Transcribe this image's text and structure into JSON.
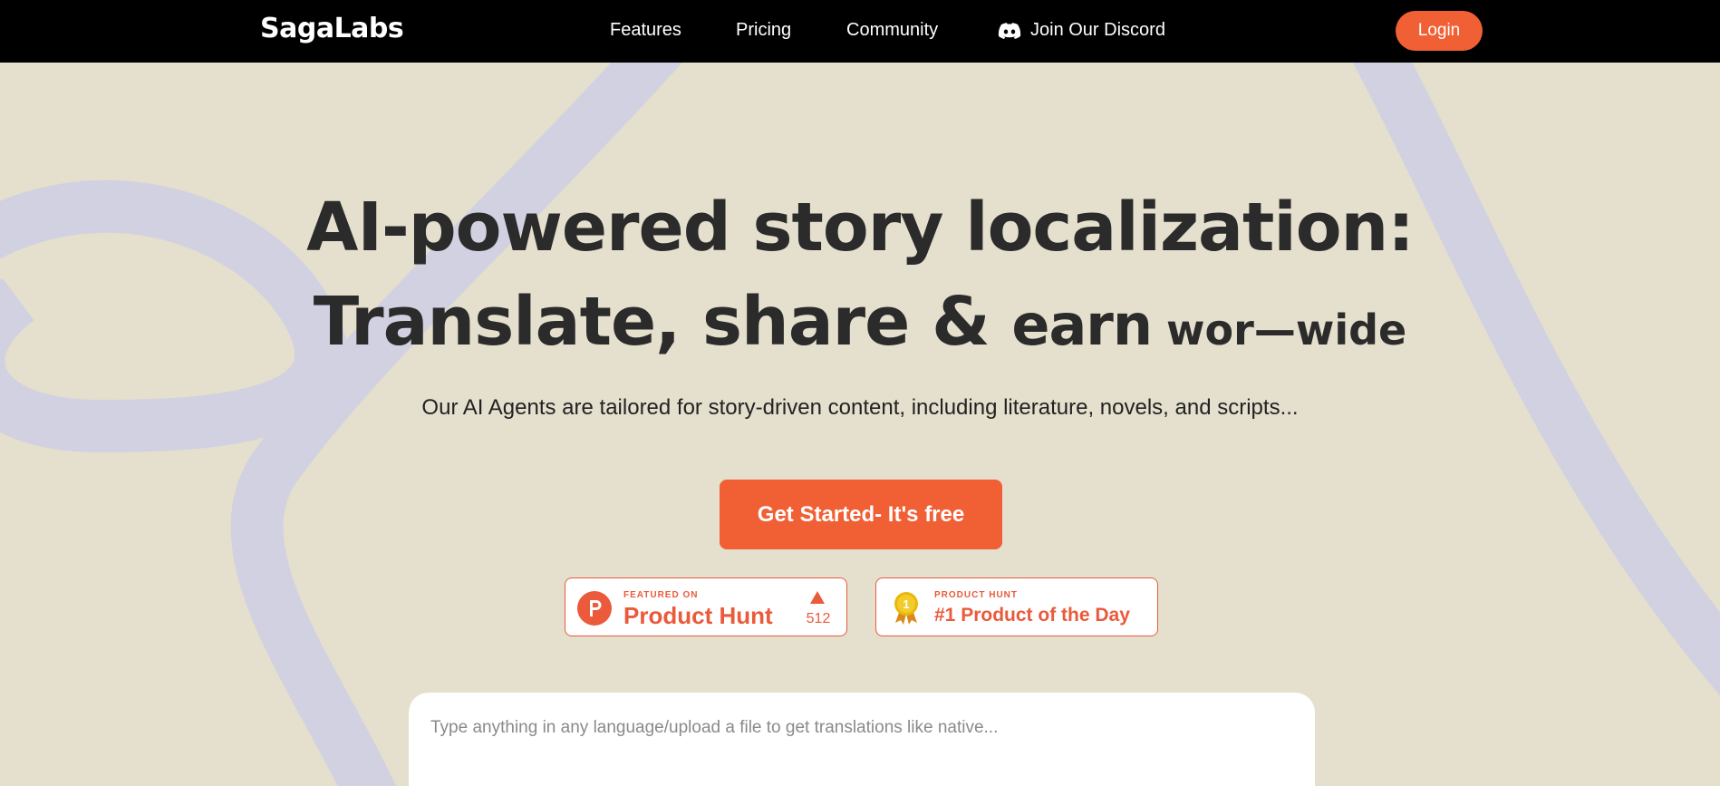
{
  "brand": {
    "name": "SagaLabs"
  },
  "nav": {
    "links": [
      {
        "label": "Features"
      },
      {
        "label": "Pricing"
      },
      {
        "label": "Community"
      }
    ],
    "discord_label": "Join Our Discord",
    "login_label": "Login"
  },
  "hero": {
    "headline_line1": "AI-powered story localization:",
    "headline_line2_main": "Translate, share & ",
    "headline_line2_earn": "earn",
    "headline_line2_worldwide": " wor—wide",
    "subtitle": "Our AI Agents are tailored for story-driven content, including literature, novels, and scripts...",
    "cta_label": "Get Started- It's free"
  },
  "badges": {
    "product_hunt": {
      "small": "FEATURED ON",
      "big": "Product Hunt",
      "upvotes": "512"
    },
    "product_of_day": {
      "small": "PRODUCT HUNT",
      "big": "#1 Product of the Day",
      "medal_number": "1"
    }
  },
  "translator": {
    "placeholder": "Type anything in any language/upload a file to get translations like native..."
  },
  "colors": {
    "accent": "#f15f35",
    "background": "#e5dfcd",
    "curve": "#d0d0e0",
    "navbar": "#000000"
  },
  "icons": [
    "discord-icon",
    "product-hunt-logo-icon",
    "upvote-arrow-icon",
    "medal-icon"
  ]
}
